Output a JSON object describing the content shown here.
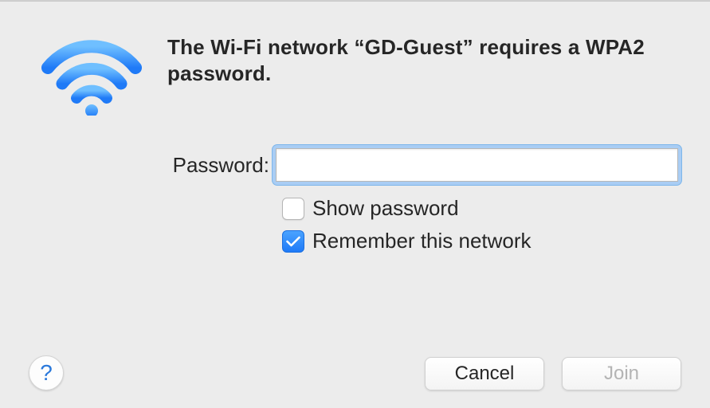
{
  "dialog": {
    "message": "The Wi-Fi network “GD-Guest” requires a WPA2 password.",
    "network_name": "GD-Guest",
    "security": "WPA2"
  },
  "form": {
    "password_label": "Password:",
    "password_value": "",
    "show_password_label": "Show password",
    "show_password_checked": false,
    "remember_label": "Remember this network",
    "remember_checked": true
  },
  "footer": {
    "help_glyph": "?",
    "cancel_label": "Cancel",
    "join_label": "Join",
    "join_enabled": false
  },
  "icons": {
    "wifi": "wifi-icon",
    "checkmark": "checkmark-icon",
    "help": "help-icon"
  },
  "colors": {
    "accent": "#2f84f5",
    "focus_ring": "#a9cdf4",
    "bg": "#ececec"
  }
}
